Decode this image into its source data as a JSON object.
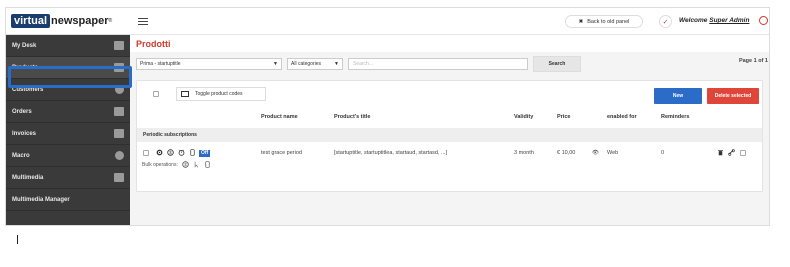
{
  "brand": {
    "logo_box": "virtual",
    "logo_rest": "newspaper",
    "logo_tm": "®"
  },
  "sidebar": {
    "items": [
      {
        "label": "My Desk"
      },
      {
        "label": "Products"
      },
      {
        "label": "Customers"
      },
      {
        "label": "Orders"
      },
      {
        "label": "Invoices"
      },
      {
        "label": "Macro"
      },
      {
        "label": "Multimedia"
      },
      {
        "label": "Multimedia Manager"
      }
    ]
  },
  "header": {
    "back_label": "Back to old panel",
    "welcome_prefix": "Welcome ",
    "user_name": "Super Admin"
  },
  "page": {
    "title": "Prodotti"
  },
  "filters": {
    "publication": "Prima - startuptitle",
    "category": "All categories",
    "search_placeholder": "Search...",
    "search_button": "Search",
    "pager": "Page 1 of 1"
  },
  "toolbar": {
    "toggle_label": "Toggle product codes",
    "new_label": "New",
    "delete_label": "Delete selected"
  },
  "table": {
    "columns": [
      "Product name",
      "Product's title",
      "Validity",
      "Price",
      "enabled for",
      "Reminders"
    ],
    "group_label": "Periodic subscriptions",
    "rows": [
      {
        "badge": "Off",
        "name": "test grace period",
        "title": "[startuptitle, startuptitlea, startaud, startasd, ...]",
        "validity": "3 month",
        "price": "€ 10,00",
        "enabled_for": "Web",
        "reminders": "0"
      }
    ],
    "bulk_label": "Bulk operations:"
  },
  "colors": {
    "accent": "#2a6cc8",
    "title_red": "#d33a2c",
    "delete": "#e0453a",
    "sidebar": "#3a3a3a"
  }
}
